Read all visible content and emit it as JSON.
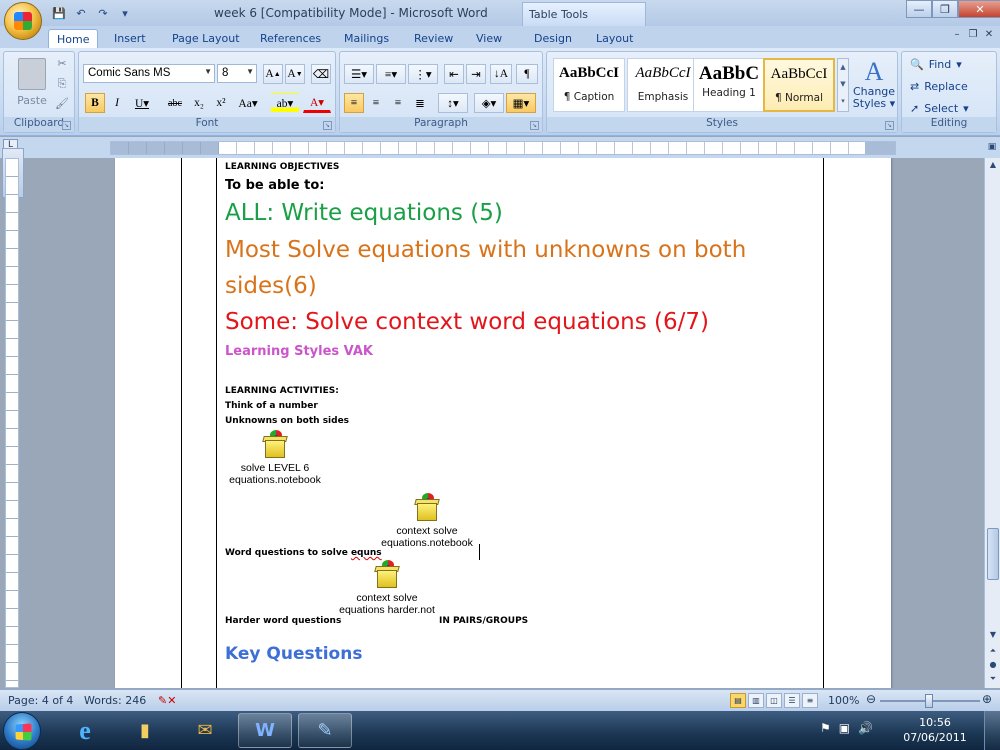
{
  "window": {
    "title": "week 6 [Compatibility Mode] - Microsoft Word",
    "context_tab_title": "Table Tools"
  },
  "tabs": [
    {
      "label": "Home"
    },
    {
      "label": "Insert"
    },
    {
      "label": "Page Layout"
    },
    {
      "label": "References"
    },
    {
      "label": "Mailings"
    },
    {
      "label": "Review"
    },
    {
      "label": "View"
    },
    {
      "label": "Design"
    },
    {
      "label": "Layout"
    }
  ],
  "ribbon": {
    "clipboard": {
      "label": "Clipboard",
      "paste": "Paste"
    },
    "font": {
      "label": "Font",
      "font_name": "Comic Sans MS",
      "font_size": "8"
    },
    "paragraph": {
      "label": "Paragraph"
    },
    "styles": {
      "label": "Styles",
      "items": [
        {
          "sample": "AaBbCcI",
          "name": "¶ Caption"
        },
        {
          "sample": "AaBbCcI",
          "name": "Emphasis"
        },
        {
          "sample": "AaBbC",
          "name": "Heading 1"
        },
        {
          "sample": "AaBbCcI",
          "name": "¶ Normal"
        }
      ],
      "change_styles": "Change Styles"
    },
    "editing": {
      "label": "Editing",
      "find": "Find",
      "replace": "Replace",
      "select": "Select"
    }
  },
  "document": {
    "heading_objectives": "LEARNING OBJECTIVES",
    "to_be_able": "To be able to:",
    "all": "ALL: Write equations (5)",
    "most_1": "Most Solve equations with unknowns on both",
    "most_2": "sides(6)",
    "some": "Some: Solve context word equations (6/7)",
    "learning_styles": "Learning Styles VAK",
    "heading_activities": "LEARNING ACTIVITIES:",
    "think": "Think of a number",
    "unknowns": "Unknowns on both sides",
    "obj1_line1": "solve LEVEL 6",
    "obj1_line2": "equations.notebook",
    "obj2_line1": "context solve",
    "obj2_line2": "equations.notebook",
    "word_questions_a": "Word questions to solve ",
    "word_questions_b": "equns",
    "obj3_line1": "context solve",
    "obj3_line2": "equations harder.not",
    "harder": "Harder word questions",
    "pairs": "IN PAIRS/GROUPS",
    "key_questions": "Key Questions",
    "colors": {
      "all": "#19a046",
      "most": "#d9731a",
      "some": "#e3151a",
      "styles": "#cc55cc",
      "key": "#3d6fd6"
    }
  },
  "status": {
    "page": "Page: 4 of 4",
    "words": "Words: 246",
    "zoom": "100%"
  },
  "taskbar": {
    "time": "10:56",
    "date": "07/06/2011"
  }
}
